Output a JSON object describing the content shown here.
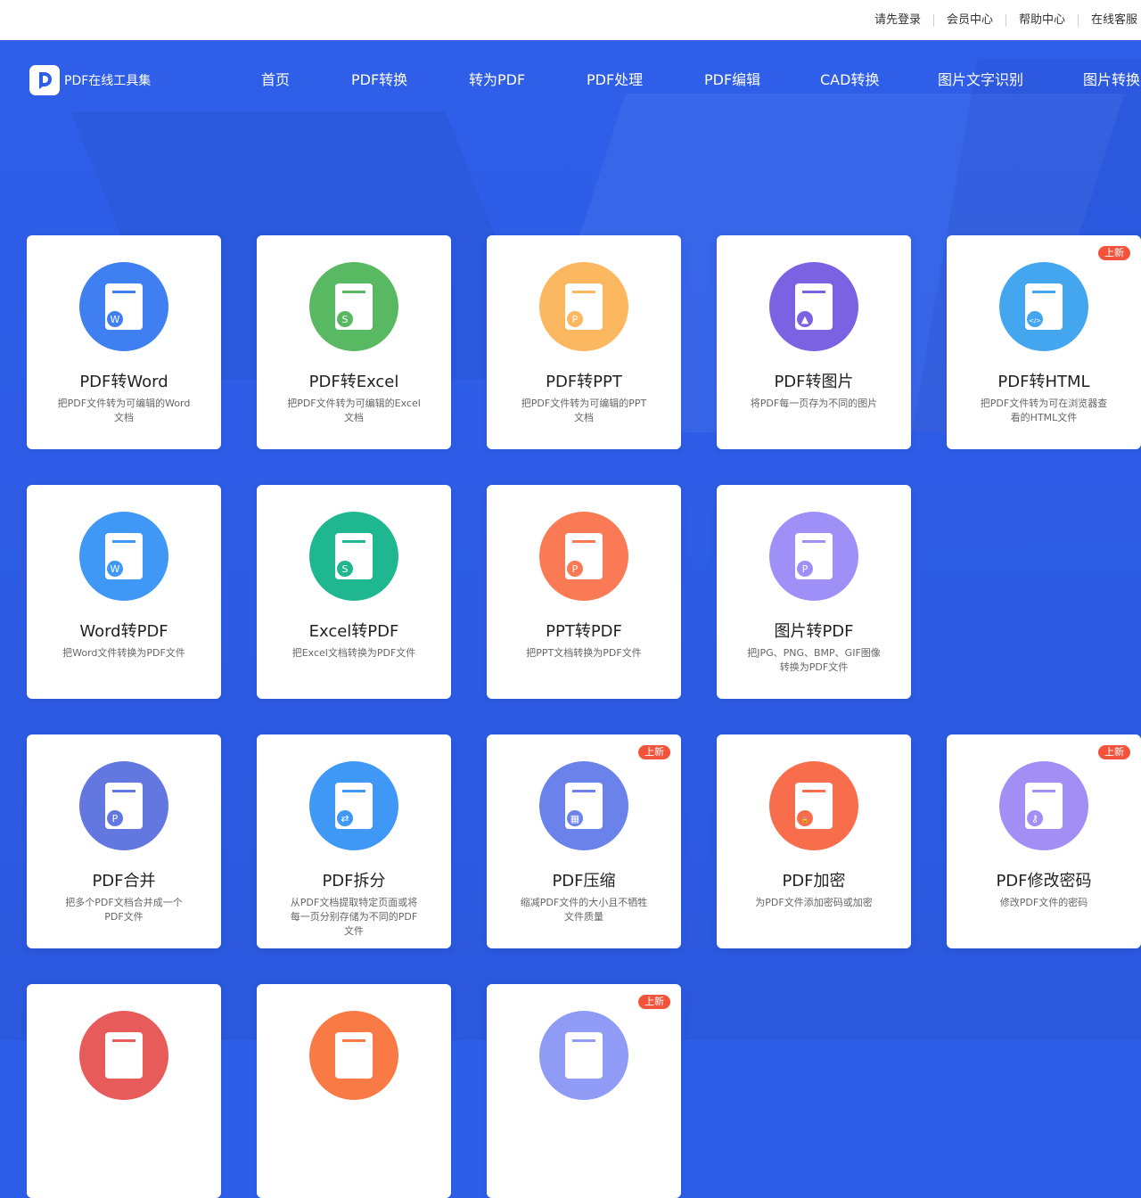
{
  "topbar": {
    "links": [
      "请先登录",
      "会员中心",
      "帮助中心",
      "在线客服"
    ]
  },
  "logo": {
    "text": "PDF在线工具集"
  },
  "nav": {
    "items": [
      "首页",
      "PDF转换",
      "转为PDF",
      "PDF处理",
      "PDF编辑",
      "CAD转换",
      "图片文字识别",
      "图片转换"
    ]
  },
  "badge_label": "上新",
  "cards": [
    {
      "title": "PDF转Word",
      "desc": "把PDF文件转为可编辑的Word文档",
      "color": "#3f7ff1",
      "icon": "word-doc-icon",
      "new": false
    },
    {
      "title": "PDF转Excel",
      "desc": "把PDF文件转为可编辑的Excel文档",
      "color": "#59b962",
      "icon": "excel-doc-icon",
      "new": false
    },
    {
      "title": "PDF转PPT",
      "desc": "把PDF文件转为可编辑的PPT文档",
      "color": "#fcb861",
      "icon": "ppt-doc-icon",
      "new": false
    },
    {
      "title": "PDF转图片",
      "desc": "将PDF每一页存为不同的图片",
      "color": "#7b62e2",
      "icon": "image-doc-icon",
      "new": false
    },
    {
      "title": "PDF转HTML",
      "desc": "把PDF文件转为可在浏览器查看的HTML文件",
      "color": "#45a6f0",
      "icon": "html-doc-icon",
      "new": true
    },
    {
      "title": "Word转PDF",
      "desc": "把Word文件转换为PDF文件",
      "color": "#3f98f5",
      "icon": "word-to-pdf-icon",
      "new": false
    },
    {
      "title": "Excel转PDF",
      "desc": "把Excel文档转换为PDF文件",
      "color": "#1fb78f",
      "icon": "excel-to-pdf-icon",
      "new": false
    },
    {
      "title": "PPT转PDF",
      "desc": "把PPT文档转换为PDF文件",
      "color": "#fa7a55",
      "icon": "ppt-to-pdf-icon",
      "new": false
    },
    {
      "title": "图片转PDF",
      "desc": "把JPG、PNG、BMP、GIF图像转换为PDF文件",
      "color": "#9e90f7",
      "icon": "image-to-pdf-icon",
      "new": false
    },
    {
      "title": "PDF合并",
      "desc": "把多个PDF文档合并成一个PDF文件",
      "color": "#6277e0",
      "icon": "merge-icon",
      "new": false
    },
    {
      "title": "PDF拆分",
      "desc": "从PDF文档提取特定页面或将每一页分别存储为不同的PDF文件",
      "color": "#3f98f5",
      "icon": "split-icon",
      "new": false
    },
    {
      "title": "PDF压缩",
      "desc": "缩减PDF文件的大小且不牺牲文件质量",
      "color": "#6a82ea",
      "icon": "compress-icon",
      "new": true
    },
    {
      "title": "PDF加密",
      "desc": "为PDF文件添加密码或加密",
      "color": "#f86e4c",
      "icon": "lock-icon",
      "new": false
    },
    {
      "title": "PDF修改密码",
      "desc": "修改PDF文件的密码",
      "color": "#a28ff6",
      "icon": "key-icon",
      "new": true
    },
    {
      "title": "",
      "desc": "",
      "color": "#e85b5b",
      "icon": "doc-icon",
      "new": false
    },
    {
      "title": "",
      "desc": "",
      "color": "#fa7a45",
      "icon": "doc-icon",
      "new": false
    },
    {
      "title": "",
      "desc": "",
      "color": "#8f9bf5",
      "icon": "doc-icon",
      "new": true
    }
  ]
}
